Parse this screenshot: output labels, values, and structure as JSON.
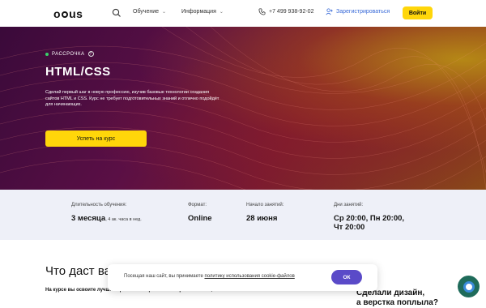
{
  "header": {
    "logo": "otus",
    "nav": [
      {
        "label": "Обучение"
      },
      {
        "label": "Информация"
      }
    ],
    "phone": "+7 499 938-92-02",
    "register": "Зарегистрироваться",
    "login": "Войти"
  },
  "hero": {
    "tag": "РАССРОЧКА",
    "tag_help": "?",
    "title": "HTML/CSS",
    "description": "Сделай первый шаг в новую профессию, изучив базовые технологии создания сайтов HTML и CSS. Курс не требует подготовительных знаний и отлично подойдёт для начинающих.",
    "cta": "Успеть на курс"
  },
  "info": {
    "duration_label": "Длительность обучения:",
    "duration_value": "3 месяца",
    "duration_note": ", 4 ак. часа в нед.",
    "format_label": "Формат:",
    "format_value": "Online",
    "start_label": "Начало занятий:",
    "start_value": "28 июня",
    "days_label": "Дни занятий:",
    "days_value_1": "Ср 20:00, Пн 20:00,",
    "days_value_2": "Чт 20:00"
  },
  "section": {
    "title": "Что даст вам",
    "learn": "На курсе вы освоите лучшие практики современной верстки сайтов, а также:",
    "side_1": "Сделали дизайн,",
    "side_2": "а верстка поплыла?"
  },
  "cookie": {
    "text": "Посещая наш сайт, вы принимаете ",
    "link": "политику использования cookie-файлов",
    "ok": "ОК"
  },
  "colors": {
    "accent": "#ffd60a",
    "link": "#3a6bd8",
    "ok_button": "#5a4ac8"
  }
}
